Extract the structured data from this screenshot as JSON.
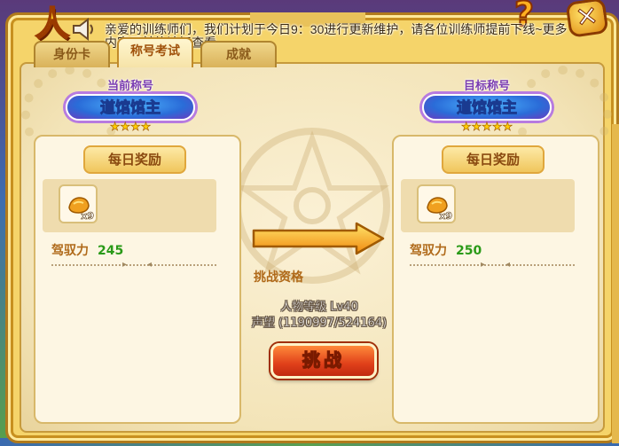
{
  "header": {
    "title_char": "人",
    "corner_char": "?",
    "close_label": "✕",
    "notice_lines": [
      "亲爱的训练师们，我们计划于今日9：30进行更新维护，请各位训练师提前下线~更多",
      "内容可前往论坛查看"
    ]
  },
  "tabs": [
    {
      "label": "身份卡",
      "active": false
    },
    {
      "label": "称号考试",
      "active": true
    },
    {
      "label": "成就",
      "active": false
    }
  ],
  "current_rank": {
    "label": "当前称号",
    "title": "道馆馆主",
    "stars": "★★★★",
    "reward_header": "每日奖励",
    "item_icon": "gold-nugget-icon",
    "item_count": "x9",
    "stat_label": "驾驭力",
    "stat_value": "245"
  },
  "target_rank": {
    "label": "目标称号",
    "title": "道馆馆主",
    "stars": "★★★★★",
    "reward_header": "每日奖励",
    "item_icon": "gold-nugget-icon",
    "item_count": "x9",
    "stat_label": "驾驭力",
    "stat_value": "250"
  },
  "qualification": {
    "title": "挑战资格",
    "level_req": "人物等级 Lv40",
    "prestige_req": "声望 (1190997/524164)"
  },
  "challenge_label": "挑战",
  "colors": {
    "accent": "#e0401a",
    "stat_value": "#2a9a18",
    "rank_label": "#7a3cb0",
    "frame": "#f5d46a"
  }
}
